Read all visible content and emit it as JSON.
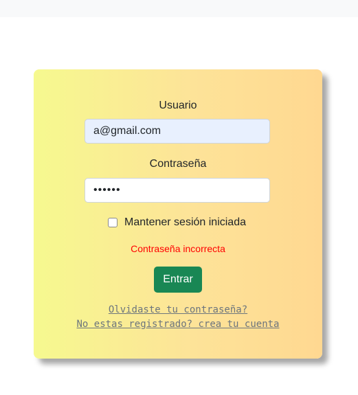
{
  "login": {
    "username_label": "Usuario",
    "username_value": "a@gmail.com",
    "password_label": "Contraseña",
    "password_value": "••••••",
    "remember_label": "Mantener sesión iniciada",
    "remember_checked": false,
    "error_message": "Contraseña incorrecta",
    "submit_label": "Entrar",
    "forgot_link": "Olvidaste tu contraseña?",
    "register_link": "No estas registrado? crea tu cuenta"
  },
  "colors": {
    "card_gradient_start": "#f6f98f",
    "card_gradient_end": "#ffd891",
    "button": "#198754",
    "error": "#ff0000",
    "link": "#6c757d",
    "autofill": "#e8f0fe"
  }
}
